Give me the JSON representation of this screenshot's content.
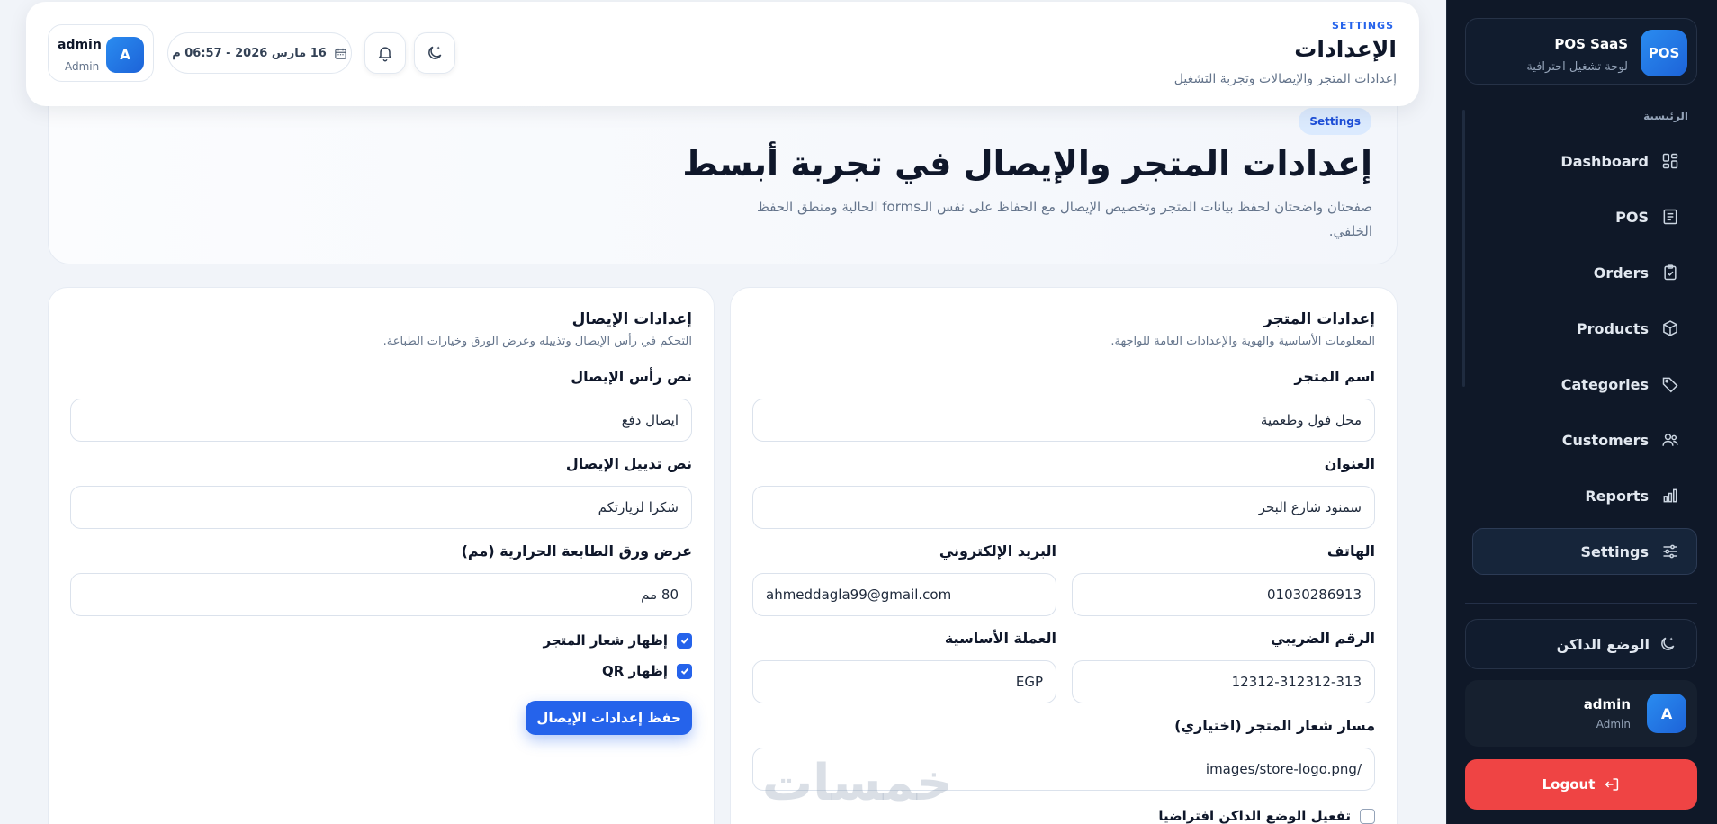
{
  "sidebar": {
    "brand_logo": "POS",
    "brand_title": "POS SaaS",
    "brand_subtitle": "لوحة تشغيل احترافية",
    "section_label": "الرئيسية",
    "items": [
      {
        "label": "Dashboard",
        "icon": "dashboard-icon"
      },
      {
        "label": "POS",
        "icon": "receipt-icon"
      },
      {
        "label": "Orders",
        "icon": "clipboard-check-icon"
      },
      {
        "label": "Products",
        "icon": "box-icon"
      },
      {
        "label": "Categories",
        "icon": "tag-icon"
      },
      {
        "label": "Customers",
        "icon": "users-icon"
      },
      {
        "label": "Reports",
        "icon": "bar-chart-icon"
      },
      {
        "label": "Settings",
        "icon": "sliders-icon",
        "active": true
      }
    ],
    "dark_mode_label": "الوضع الداكن",
    "user": {
      "avatar": "A",
      "name": "admin",
      "role": "Admin"
    },
    "logout_label": "Logout"
  },
  "header": {
    "eyebrow": "SETTINGS",
    "title": "الإعدادات",
    "subtitle": "إعدادات المتجر والإيصالات وتجربة التشغيل",
    "date_time": "16 مارس 2026 - 06:57 م",
    "user": {
      "avatar": "A",
      "name": "admin",
      "role": "Admin"
    }
  },
  "hero": {
    "pill": "Settings",
    "title": "إعدادات المتجر والإيصال في تجربة أبسط",
    "description": "صفحتان واضحتان لحفظ بيانات المتجر وتخصيص الإيصال مع الحفاظ على نفس الـforms الحالية ومنطق الحفظ الخلفي."
  },
  "store_settings": {
    "title": "إعدادات المتجر",
    "description": "المعلومات الأساسية والهوية والإعدادات العامة للواجهة.",
    "store_name_label": "اسم المتجر",
    "store_name_value": "محل فول وطعمية",
    "address_label": "العنوان",
    "address_value": "سمنود شارع البحر",
    "phone_label": "الهاتف",
    "phone_value": "01030286913",
    "email_label": "البريد الإلكتروني",
    "email_value": "ahmeddagla99@gmail.com",
    "tax_label": "الرقم الضريبي",
    "tax_value": "12312-312312-313",
    "currency_label": "العملة الأساسية",
    "currency_value": "EGP",
    "logo_path_label": "مسار شعار المتجر (اختياري)",
    "logo_path_value": "images/store-logo.png/",
    "dark_default_label": "تفعيل الوضع الداكن افتراضيا"
  },
  "receipt_settings": {
    "title": "إعدادات الإيصال",
    "description": "التحكم في رأس الإيصال وتذييله وعرض الورق وخيارات الطباعة.",
    "header_label": "نص رأس الإيصال",
    "header_value": "ايصال دفع",
    "footer_label": "نص تذييل الإيصال",
    "footer_value": "شكرا لزيارتكم",
    "paper_width_label": "عرض ورق الطابعة الحرارية (مم)",
    "paper_width_value": "80 مم",
    "show_logo_label": "إظهار شعار المتجر",
    "show_qr_label": "إظهار QR",
    "save_label": "حفظ إعدادات الإيصال"
  },
  "watermark": "خمسات",
  "colors": {
    "accent": "#2563eb",
    "sidebar_bg": "#0f1828",
    "logout": "#ef4444"
  }
}
